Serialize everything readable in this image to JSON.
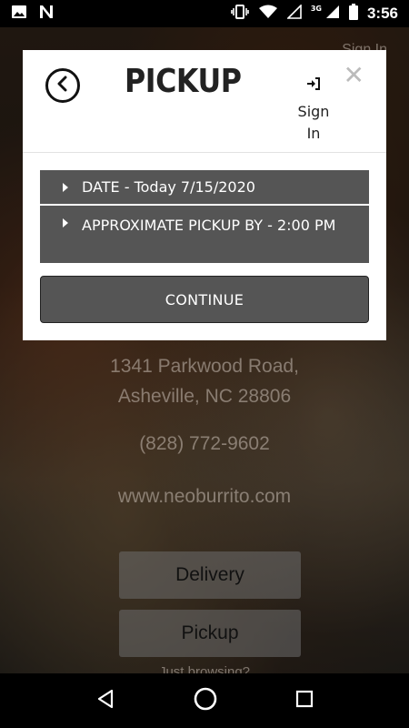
{
  "status_bar": {
    "time": "3:56",
    "network": "3G",
    "icons": [
      "image-icon",
      "n-app-icon",
      "vibrate-icon",
      "wifi-icon",
      "signal-icon",
      "battery-icon"
    ]
  },
  "background": {
    "sign_in": "Sign In",
    "address_line1": "1341 Parkwood Road,",
    "address_line2": "Asheville, NC 28806",
    "phone": "(828) 772-9602",
    "website": "www.neoburrito.com",
    "delivery_label": "Delivery",
    "pickup_label": "Pickup",
    "browsing_text": "Just browsing?"
  },
  "modal": {
    "title": "PICKUP",
    "sign_in_line1": "Sign",
    "sign_in_line2": "In",
    "close_symbol": "✕",
    "date_option": "DATE - Today 7/15/2020",
    "time_option": "APPROXIMATE PICKUP BY - 2:00 PM",
    "continue_label": "CONTINUE"
  },
  "colors": {
    "option_bg": "#555555",
    "modal_bg": "#ffffff",
    "close_color": "#bbbbbb"
  }
}
